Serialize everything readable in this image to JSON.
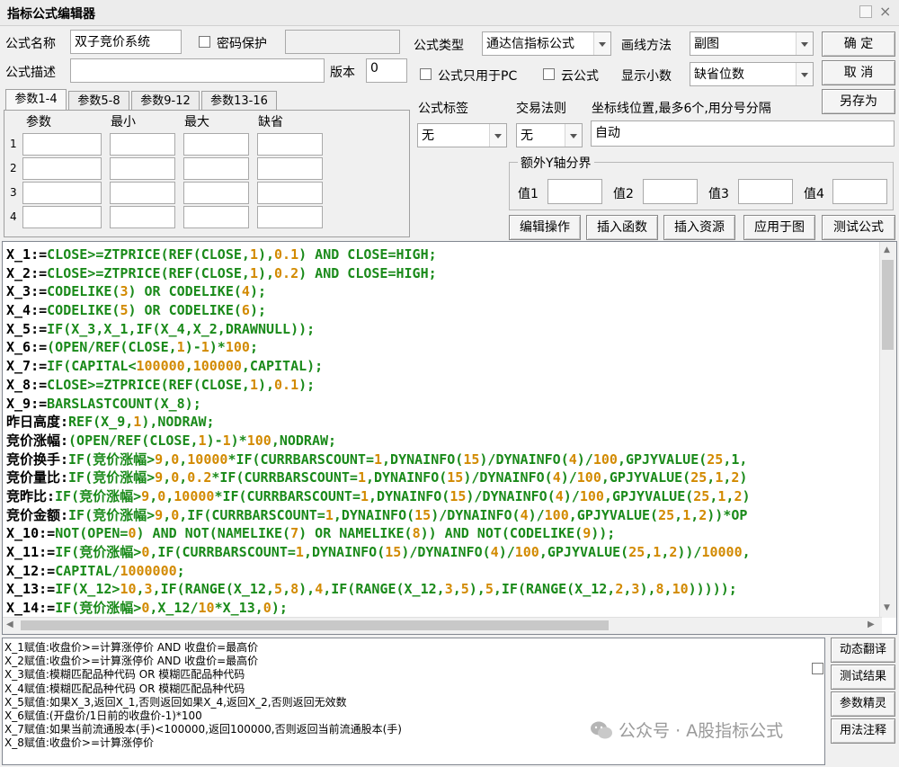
{
  "window": {
    "title": "指标公式编辑器"
  },
  "form": {
    "name_label": "公式名称",
    "name_value": "双子竞价系统",
    "password_label": "密码保护",
    "desc_label": "公式描述",
    "desc_value": "",
    "version_label": "版本",
    "version_value": "0",
    "type_label": "公式类型",
    "type_value": "通达信指标公式",
    "draw_label": "画线方法",
    "draw_value": "副图",
    "pc_only_label": "公式只用于PC",
    "cloud_label": "云公式",
    "decimals_label": "显示小数",
    "decimals_value": "缺省位数",
    "tag_label": "公式标签",
    "tag_value": "无",
    "rule_label": "交易法则",
    "rule_value": "无",
    "axis_label": "坐标线位置,最多6个,用分号分隔",
    "axis_value": "自动",
    "yaxis_group": "额外Y轴分界",
    "y_labels": [
      "值1",
      "值2",
      "值3",
      "值4"
    ]
  },
  "params": {
    "tabs": [
      "参数1-4",
      "参数5-8",
      "参数9-12",
      "参数13-16"
    ],
    "headers": [
      "参数",
      "最小",
      "最大",
      "缺省"
    ],
    "rows": [
      "1",
      "2",
      "3",
      "4"
    ]
  },
  "buttons": {
    "ok": "确  定",
    "cancel": "取  消",
    "save_as": "另存为",
    "edit_ops": "编辑操作",
    "insert_func": "插入函数",
    "insert_res": "插入资源",
    "apply": "应用于图",
    "test": "测试公式",
    "dyn_translate": "动态翻译",
    "test_result": "测试结果",
    "param_wizard": "参数精灵",
    "usage_notes": "用法注释"
  },
  "code_lines": [
    [
      [
        "X_1:=",
        ""
      ],
      [
        "CLOSE>=ZTPRICE(REF(CLOSE,",
        "g"
      ],
      [
        "1",
        "o"
      ],
      [
        "),",
        "g"
      ],
      [
        "0.1",
        "o"
      ],
      [
        ") AND CLOSE=HIGH;",
        "g"
      ]
    ],
    [
      [
        "X_2:=",
        ""
      ],
      [
        "CLOSE>=ZTPRICE(REF(CLOSE,",
        "g"
      ],
      [
        "1",
        "o"
      ],
      [
        "),",
        "g"
      ],
      [
        "0.2",
        "o"
      ],
      [
        ") AND CLOSE=HIGH;",
        "g"
      ]
    ],
    [
      [
        "X_3:=",
        ""
      ],
      [
        "CODELIKE(",
        "g"
      ],
      [
        "3",
        "o"
      ],
      [
        ") OR CODELIKE(",
        "g"
      ],
      [
        "4",
        "o"
      ],
      [
        ");",
        "g"
      ]
    ],
    [
      [
        "X_4:=",
        ""
      ],
      [
        "CODELIKE(",
        "g"
      ],
      [
        "5",
        "o"
      ],
      [
        ") OR CODELIKE(",
        "g"
      ],
      [
        "6",
        "o"
      ],
      [
        ");",
        "g"
      ]
    ],
    [
      [
        "X_5:=",
        ""
      ],
      [
        "IF(X_3,X_1,IF(X_4,X_2,DRAWNULL));",
        "g"
      ]
    ],
    [
      [
        "X_6:=",
        ""
      ],
      [
        "(OPEN/REF(CLOSE,",
        "g"
      ],
      [
        "1",
        "o"
      ],
      [
        ")-",
        "g"
      ],
      [
        "1",
        "o"
      ],
      [
        ")*",
        "g"
      ],
      [
        "100",
        "o"
      ],
      [
        ";",
        "g"
      ]
    ],
    [
      [
        "X_7:=",
        ""
      ],
      [
        "IF(CAPITAL<",
        "g"
      ],
      [
        "100000",
        "o"
      ],
      [
        ",",
        "g"
      ],
      [
        "100000",
        "o"
      ],
      [
        ",CAPITAL);",
        "g"
      ]
    ],
    [
      [
        "X_8:=",
        ""
      ],
      [
        "CLOSE>=ZTPRICE(REF(CLOSE,",
        "g"
      ],
      [
        "1",
        "o"
      ],
      [
        "),",
        "g"
      ],
      [
        "0.1",
        "o"
      ],
      [
        ");",
        "g"
      ]
    ],
    [
      [
        "X_9:=",
        ""
      ],
      [
        "BARSLASTCOUNT(X_8);",
        "g"
      ]
    ],
    [
      [
        "昨日高度:",
        ""
      ],
      [
        "REF(X_9,",
        "g"
      ],
      [
        "1",
        "o"
      ],
      [
        "),NODRAW;",
        "g"
      ]
    ],
    [
      [
        "竞价涨幅:",
        ""
      ],
      [
        "(OPEN/REF(CLOSE,",
        "g"
      ],
      [
        "1",
        "o"
      ],
      [
        ")-",
        "g"
      ],
      [
        "1",
        "o"
      ],
      [
        ")*",
        "g"
      ],
      [
        "100",
        "o"
      ],
      [
        ",NODRAW;",
        "g"
      ]
    ],
    [
      [
        "竞价换手:",
        ""
      ],
      [
        "IF(竞价涨幅>",
        "g"
      ],
      [
        "9",
        "o"
      ],
      [
        ",",
        "g"
      ],
      [
        "0",
        "o"
      ],
      [
        ",",
        "g"
      ],
      [
        "10000",
        "o"
      ],
      [
        "*IF(CURRBARSCOUNT=",
        "g"
      ],
      [
        "1",
        "o"
      ],
      [
        ",DYNAINFO(",
        "g"
      ],
      [
        "15",
        "o"
      ],
      [
        ")/DYNAINFO(",
        "g"
      ],
      [
        "4",
        "o"
      ],
      [
        ")/",
        "g"
      ],
      [
        "100",
        "o"
      ],
      [
        ",GPJYVALUE(",
        "g"
      ],
      [
        "25",
        "o"
      ],
      [
        ",1,",
        "g"
      ]
    ],
    [
      [
        "竞价量比:",
        ""
      ],
      [
        "IF(竞价涨幅>",
        "g"
      ],
      [
        "9",
        "o"
      ],
      [
        ",",
        "g"
      ],
      [
        "0",
        "o"
      ],
      [
        ",",
        "g"
      ],
      [
        "0.2",
        "o"
      ],
      [
        "*IF(CURRBARSCOUNT=",
        "g"
      ],
      [
        "1",
        "o"
      ],
      [
        ",DYNAINFO(",
        "g"
      ],
      [
        "15",
        "o"
      ],
      [
        ")/DYNAINFO(",
        "g"
      ],
      [
        "4",
        "o"
      ],
      [
        ")/",
        "g"
      ],
      [
        "100",
        "o"
      ],
      [
        ",GPJYVALUE(",
        "g"
      ],
      [
        "25",
        "o"
      ],
      [
        ",",
        "g"
      ],
      [
        "1",
        "o"
      ],
      [
        ",",
        "g"
      ],
      [
        "2",
        "o"
      ],
      [
        ")",
        "g"
      ]
    ],
    [
      [
        "竞昨比:",
        ""
      ],
      [
        "IF(竞价涨幅>",
        "g"
      ],
      [
        "9",
        "o"
      ],
      [
        ",",
        "g"
      ],
      [
        "0",
        "o"
      ],
      [
        ",",
        "g"
      ],
      [
        "10000",
        "o"
      ],
      [
        "*IF(CURRBARSCOUNT=",
        "g"
      ],
      [
        "1",
        "o"
      ],
      [
        ",DYNAINFO(",
        "g"
      ],
      [
        "15",
        "o"
      ],
      [
        ")/DYNAINFO(",
        "g"
      ],
      [
        "4",
        "o"
      ],
      [
        ")/",
        "g"
      ],
      [
        "100",
        "o"
      ],
      [
        ",GPJYVALUE(",
        "g"
      ],
      [
        "25",
        "o"
      ],
      [
        ",",
        "g"
      ],
      [
        "1",
        "o"
      ],
      [
        ",",
        "g"
      ],
      [
        "2",
        "o"
      ],
      [
        ")",
        "g"
      ]
    ],
    [
      [
        "竞价金额:",
        ""
      ],
      [
        "IF(竞价涨幅>",
        "g"
      ],
      [
        "9",
        "o"
      ],
      [
        ",",
        "g"
      ],
      [
        "0",
        "o"
      ],
      [
        ",IF(CURRBARSCOUNT=",
        "g"
      ],
      [
        "1",
        "o"
      ],
      [
        ",DYNAINFO(",
        "g"
      ],
      [
        "15",
        "o"
      ],
      [
        ")/DYNAINFO(",
        "g"
      ],
      [
        "4",
        "o"
      ],
      [
        ")/",
        "g"
      ],
      [
        "100",
        "o"
      ],
      [
        ",GPJYVALUE(",
        "g"
      ],
      [
        "25",
        "o"
      ],
      [
        ",",
        "g"
      ],
      [
        "1",
        "o"
      ],
      [
        ",",
        "g"
      ],
      [
        "2",
        "o"
      ],
      [
        "))*OP",
        "g"
      ]
    ],
    [
      [
        "X_10:=",
        ""
      ],
      [
        "NOT(OPEN=",
        "g"
      ],
      [
        "0",
        "o"
      ],
      [
        ") AND NOT(NAMELIKE(",
        "g"
      ],
      [
        "7",
        "o"
      ],
      [
        ") OR NAMELIKE(",
        "g"
      ],
      [
        "8",
        "o"
      ],
      [
        ")) AND NOT(CODELIKE(",
        "g"
      ],
      [
        "9",
        "o"
      ],
      [
        "));",
        "g"
      ]
    ],
    [
      [
        "X_11:=",
        ""
      ],
      [
        "IF(竞价涨幅>",
        "g"
      ],
      [
        "0",
        "o"
      ],
      [
        ",IF(CURRBARSCOUNT=",
        "g"
      ],
      [
        "1",
        "o"
      ],
      [
        ",DYNAINFO(",
        "g"
      ],
      [
        "15",
        "o"
      ],
      [
        ")/DYNAINFO(",
        "g"
      ],
      [
        "4",
        "o"
      ],
      [
        ")/",
        "g"
      ],
      [
        "100",
        "o"
      ],
      [
        ",GPJYVALUE(",
        "g"
      ],
      [
        "25",
        "o"
      ],
      [
        ",",
        "g"
      ],
      [
        "1",
        "o"
      ],
      [
        ",",
        "g"
      ],
      [
        "2",
        "o"
      ],
      [
        "))/",
        "g"
      ],
      [
        "10000",
        "o"
      ],
      [
        ",",
        "g"
      ]
    ],
    [
      [
        "X_12:=",
        ""
      ],
      [
        "CAPITAL/",
        "g"
      ],
      [
        "1000000",
        "o"
      ],
      [
        ";",
        "g"
      ]
    ],
    [
      [
        "X_13:=",
        ""
      ],
      [
        "IF(X_12>",
        "g"
      ],
      [
        "10",
        "o"
      ],
      [
        ",",
        "g"
      ],
      [
        "3",
        "o"
      ],
      [
        ",IF(RANGE(X_12,",
        "g"
      ],
      [
        "5",
        "o"
      ],
      [
        ",",
        "g"
      ],
      [
        "8",
        "o"
      ],
      [
        "),",
        "g"
      ],
      [
        "4",
        "o"
      ],
      [
        ",IF(RANGE(X_12,",
        "g"
      ],
      [
        "3",
        "o"
      ],
      [
        ",",
        "g"
      ],
      [
        "5",
        "o"
      ],
      [
        "),",
        "g"
      ],
      [
        "5",
        "o"
      ],
      [
        ",IF(RANGE(X_12,",
        "g"
      ],
      [
        "2",
        "o"
      ],
      [
        ",",
        "g"
      ],
      [
        "3",
        "o"
      ],
      [
        "),",
        "g"
      ],
      [
        "8",
        "o"
      ],
      [
        ",",
        "g"
      ],
      [
        "10",
        "o"
      ],
      [
        ")))));",
        "g"
      ]
    ],
    [
      [
        "X_14:=",
        ""
      ],
      [
        "IF(竞价涨幅>",
        "g"
      ],
      [
        "0",
        "o"
      ],
      [
        ",X_12/",
        "g"
      ],
      [
        "10",
        "o"
      ],
      [
        "*X_13,",
        "g"
      ],
      [
        "0",
        "o"
      ],
      [
        ");",
        "g"
      ]
    ]
  ],
  "messages": [
    "X_1赋值:收盘价>=计算涨停价 AND 收盘价=最高价",
    "X_2赋值:收盘价>=计算涨停价 AND 收盘价=最高价",
    "X_3赋值:模糊匹配品种代码 OR 模糊匹配品种代码",
    "X_4赋值:模糊匹配品种代码 OR 模糊匹配品种代码",
    "X_5赋值:如果X_3,返回X_1,否则返回如果X_4,返回X_2,否则返回无效数",
    "X_6赋值:(开盘价/1日前的收盘价-1)*100",
    "X_7赋值:如果当前流通股本(手)<100000,返回100000,否则返回当前流通股本(手)",
    "X_8赋值:收盘价>=计算涨停价"
  ],
  "watermark": "公众号 · A股指标公式"
}
